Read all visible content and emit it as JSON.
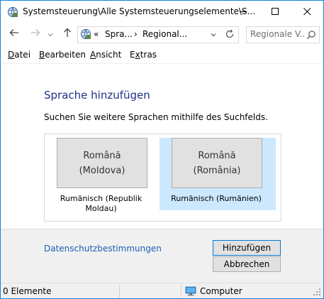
{
  "window": {
    "title": "Systemsteuerung\\Alle Systemsteuerungselemente\\S...",
    "accent": "#1883d7"
  },
  "nav": {
    "back_icon": "arrow-left-icon",
    "forward_icon": "arrow-right-icon",
    "recent_icon": "chevron-down-icon",
    "up_icon": "arrow-up-icon",
    "refresh_icon": "refresh-icon"
  },
  "address": {
    "overflow": "«",
    "segments": [
      "Spra...",
      "Regional..."
    ],
    "separator": "›"
  },
  "search": {
    "placeholder": "Regionale V...",
    "value": ""
  },
  "menu": {
    "items": [
      {
        "label": "Datei",
        "accel": "D",
        "rest": "atei"
      },
      {
        "label": "Bearbeiten",
        "accel": "B",
        "rest": "earbeiten"
      },
      {
        "label": "Ansicht",
        "accel": "A",
        "rest": "nsicht"
      },
      {
        "label": "Extras",
        "accel": "x",
        "pre": "E",
        "rest": "tras"
      }
    ]
  },
  "content": {
    "title": "Sprache hinzufügen",
    "instruction": "Suchen Sie weitere Sprachen mithilfe des Suchfelds.",
    "title_color": "#1e3287",
    "selected_color": "#cce8ff"
  },
  "languages": [
    {
      "native_line1": "Română",
      "native_line2": "(Moldova)",
      "caption": "Rumänisch (Republik Moldau)",
      "selected": false
    },
    {
      "native_line1": "Română",
      "native_line2": "(România)",
      "caption": "Rumänisch (Rumänien)",
      "selected": true
    }
  ],
  "footer": {
    "privacy_link": "Datenschutzbestimmungen",
    "add_button": "Hinzufügen",
    "cancel_button": "Abbrechen",
    "link_color": "#1a5fb4"
  },
  "status": {
    "count": "0 Elemente",
    "location": "Computer"
  }
}
